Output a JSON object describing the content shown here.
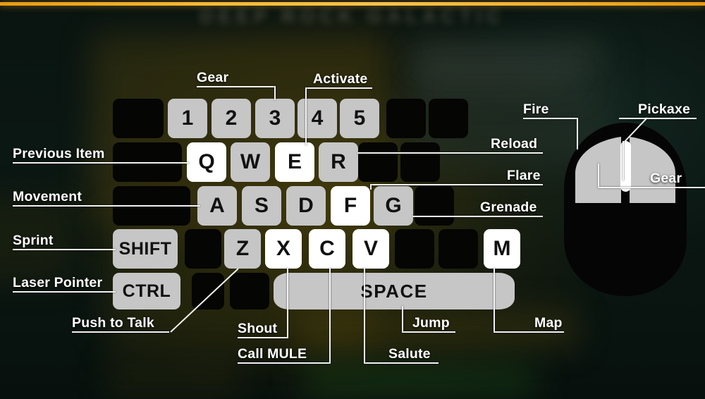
{
  "screen": {
    "title": "DEEP ROCK GALACTIC",
    "accent_orange": "#e79a12",
    "key_grey": "#c6c6c6",
    "key_white": "#ffffff",
    "key_dark": "#050504",
    "background": "#0c1612"
  },
  "keyboard": {
    "number_row": [
      {
        "cap": "1",
        "state": "grey"
      },
      {
        "cap": "2",
        "state": "grey"
      },
      {
        "cap": "3",
        "state": "grey"
      },
      {
        "cap": "4",
        "state": "grey"
      },
      {
        "cap": "5",
        "state": "grey"
      }
    ],
    "qwer_row": [
      {
        "cap": "Q",
        "state": "white"
      },
      {
        "cap": "W",
        "state": "grey"
      },
      {
        "cap": "E",
        "state": "white"
      },
      {
        "cap": "R",
        "state": "grey"
      }
    ],
    "asdfg_row": [
      {
        "cap": "A",
        "state": "grey"
      },
      {
        "cap": "S",
        "state": "grey"
      },
      {
        "cap": "D",
        "state": "grey"
      },
      {
        "cap": "F",
        "state": "white"
      },
      {
        "cap": "G",
        "state": "grey"
      }
    ],
    "zxcvm_row": [
      {
        "cap": "SHIFT",
        "state": "grey"
      },
      {
        "cap": "Z",
        "state": "grey"
      },
      {
        "cap": "X",
        "state": "white"
      },
      {
        "cap": "C",
        "state": "white"
      },
      {
        "cap": "V",
        "state": "white"
      },
      {
        "cap": "M",
        "state": "white"
      }
    ],
    "bottom_row": [
      {
        "cap": "CTRL",
        "state": "grey"
      },
      {
        "cap": "SPACE",
        "state": "grey"
      }
    ]
  },
  "callouts": {
    "gear": "Gear",
    "activate": "Activate",
    "previous_item": "Previous Item",
    "movement": "Movement",
    "sprint": "Sprint",
    "laser_pointer": "Laser Pointer",
    "push_to_talk": "Push to Talk",
    "shout": "Shout",
    "call_mule": "Call MULE",
    "salute": "Salute",
    "jump": "Jump",
    "map": "Map",
    "reload": "Reload",
    "flare": "Flare",
    "grenade": "Grenade",
    "fire": "Fire",
    "pickaxe": "Pickaxe",
    "mouse_gear": "Gear"
  }
}
